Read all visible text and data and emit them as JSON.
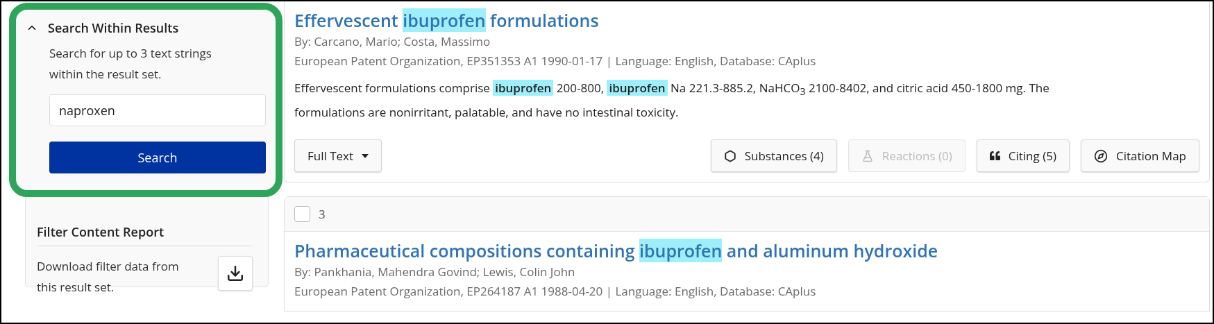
{
  "sidebar": {
    "search_within": {
      "title": "Search Within Results",
      "expanded": true,
      "description": "Search for up to 3 text strings within the result set.",
      "input": {
        "value": "naproxen"
      },
      "button": "Search"
    },
    "filter_report": {
      "title": "Filter Content Report",
      "description": "Download filter data from this result set."
    }
  },
  "results": [
    {
      "title": [
        {
          "text": "Effervescent ",
          "highlight": false
        },
        {
          "text": "ibuprofen",
          "highlight": true
        },
        {
          "text": " formulations",
          "highlight": false
        }
      ],
      "authors": "By: Carcano, Mario; Costa, Massimo",
      "source": "European Patent Organization, EP351353 A1 1990-01-17 | Language: English, Database: CAplus",
      "abstract": [
        {
          "text": "Effervescent formulations comprise ",
          "highlight": false
        },
        {
          "text": "ibuprofen",
          "highlight": true
        },
        {
          "text": " 200-800, ",
          "highlight": false
        },
        {
          "text": "ibuprofen",
          "highlight": true
        },
        {
          "text": " Na 221.3-885.2, NaHCO$_{3}$ 2100-8402, and citric acid 450-1800 mg. The formulations are nonirritant, palatable, and have no intestinal toxicity.",
          "highlight": false
        }
      ],
      "full_text": "Full Text",
      "actions": [
        {
          "kind": "substances",
          "label": "Substances (4)",
          "disabled": false
        },
        {
          "kind": "reactions",
          "label": "Reactions (0)",
          "disabled": true
        },
        {
          "kind": "citing",
          "label": "Citing (5)",
          "disabled": false
        },
        {
          "kind": "citation_map",
          "label": "Citation Map",
          "disabled": false
        }
      ]
    },
    {
      "number": "3",
      "checked": false,
      "title": [
        {
          "text": "Pharmaceutical compositions containing ",
          "highlight": false
        },
        {
          "text": "ibuprofen",
          "highlight": true
        },
        {
          "text": " and aluminum hydroxide",
          "highlight": false
        }
      ],
      "authors": "By: Pankhania, Mahendra Govind; Lewis, Colin John",
      "source": "European Patent Organization, EP264187 A1 1988-04-20 | Language: English, Database: CAplus"
    }
  ]
}
